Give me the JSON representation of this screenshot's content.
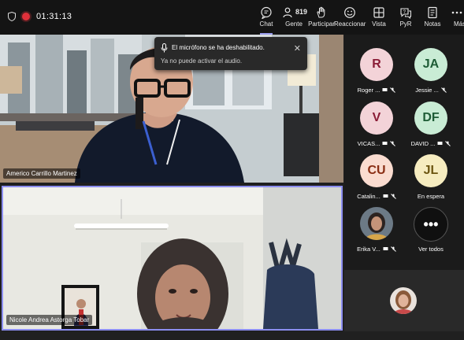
{
  "topbar": {
    "timer": "01:31:13",
    "buttons": {
      "chat": "Chat",
      "people": "Gente",
      "people_count": "819",
      "raise": "Participar",
      "react": "Reaccionar",
      "view": "Vista",
      "qa": "PyR",
      "notes": "Notas",
      "more": "Más"
    }
  },
  "toast": {
    "title": "El micrófono se ha deshabilitado.",
    "message": "Ya no puede activar el audio."
  },
  "videos": [
    {
      "name": "Americo Carrillo Martinez"
    },
    {
      "name": "Nicole Andrea Astorga Tobar"
    }
  ],
  "participants": [
    {
      "initials": "R",
      "name": "Roger ...",
      "color": "#f3d3d8",
      "text_color": "#8a1c36"
    },
    {
      "initials": "JA",
      "name": "Jessie ...",
      "color": "#c9ecd5",
      "text_color": "#1e5c36"
    },
    {
      "initials": "V",
      "name": "VICAS...",
      "color": "#f3d3d8",
      "text_color": "#8a1c36"
    },
    {
      "initials": "DF",
      "name": "DAVID ...",
      "color": "#c9ecd5",
      "text_color": "#1e5c36"
    },
    {
      "initials": "CU",
      "name": "Catalin...",
      "color": "#fadcd0",
      "text_color": "#8a2e14"
    },
    {
      "initials": "JL",
      "name": "En espera",
      "color": "#f6ecc0",
      "text_color": "#6b5410"
    },
    {
      "initials": "",
      "name": "Erika V...",
      "color": "#3a3a3a",
      "text_color": "#ffffff"
    },
    {
      "initials": "•••",
      "name": "Ver todos",
      "color": "#101010",
      "text_color": "#ffffff"
    }
  ]
}
